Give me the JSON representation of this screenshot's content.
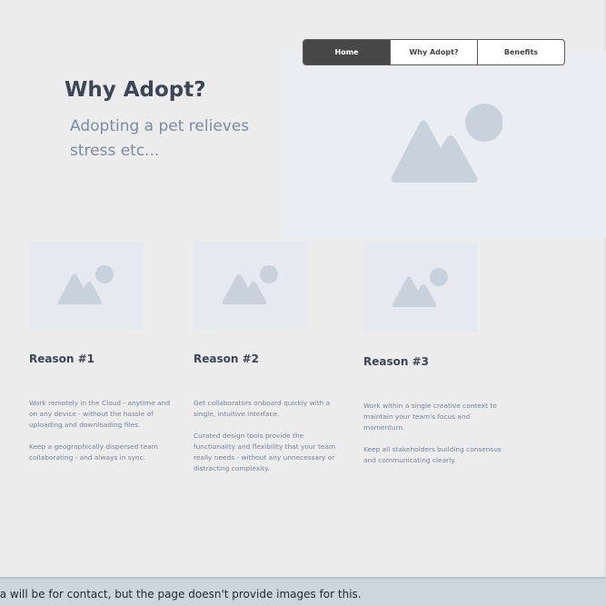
{
  "nav": {
    "tabs": [
      {
        "label": "Home",
        "active": true
      },
      {
        "label": "Why Adopt?",
        "active": false
      },
      {
        "label": "Benefits",
        "active": false
      }
    ]
  },
  "hero": {
    "title": "Why Adopt?",
    "subtitle": "Adopting a pet relieves stress etc...",
    "image_icon": "image-placeholder-icon"
  },
  "reasons": [
    {
      "title": "Reason #1",
      "paragraphs": [
        "Work remotely in the Cloud - anytime and on any device - without the hassle of uploading and downloading files.",
        "Keep a geographically dispersed team collaborating - and always in sync."
      ]
    },
    {
      "title": "Reason #2",
      "paragraphs": [
        "Get collaborators onboard quickly with a single, intuitive interface.",
        "Curated design tools provide the functionality and flexibility that your team really needs - without any unnecessary or distracting complexity."
      ]
    },
    {
      "title": "Reason #3",
      "paragraphs": [
        "Work within a single creative context to maintain your team's focus and momentum.",
        "Keep all stakeholders  building consensus and communicating clearly."
      ]
    }
  ],
  "footer": {
    "text": "This area will be for contact, but the page doesn't provide images for this."
  },
  "colors": {
    "background": "#ececec",
    "placeholder": "#c8d1dc",
    "footer_bg": "#cdd5df",
    "nav_active": "#474747"
  }
}
